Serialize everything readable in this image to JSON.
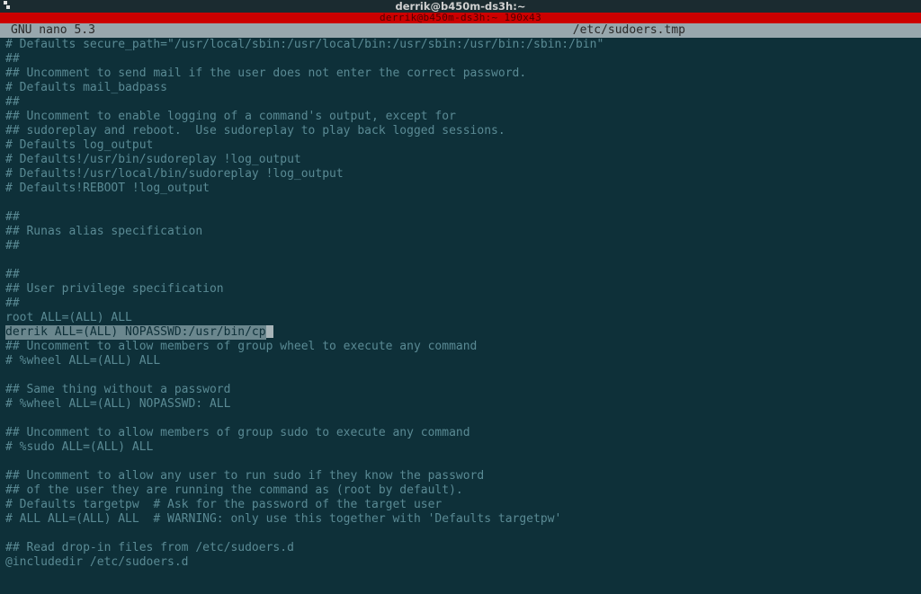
{
  "window": {
    "title": "derrik@b450m-ds3h:~",
    "subtitle": "derrik@b450m-ds3h:~ 190x43"
  },
  "nano": {
    "app_label": "GNU nano 5.3",
    "filename": "/etc/sudoers.tmp"
  },
  "file_lines": [
    "# Defaults secure_path=\"/usr/local/sbin:/usr/local/bin:/usr/sbin:/usr/bin:/sbin:/bin\"",
    "##",
    "## Uncomment to send mail if the user does not enter the correct password.",
    "# Defaults mail_badpass",
    "##",
    "## Uncomment to enable logging of a command's output, except for",
    "## sudoreplay and reboot.  Use sudoreplay to play back logged sessions.",
    "# Defaults log_output",
    "# Defaults!/usr/bin/sudoreplay !log_output",
    "# Defaults!/usr/local/bin/sudoreplay !log_output",
    "# Defaults!REBOOT !log_output",
    "",
    "##",
    "## Runas alias specification",
    "##",
    "",
    "##",
    "## User privilege specification",
    "##",
    "root ALL=(ALL) ALL",
    "derrik ALL=(ALL) NOPASSWD:/usr/bin/cp",
    "## Uncomment to allow members of group wheel to execute any command",
    "# %wheel ALL=(ALL) ALL",
    "",
    "## Same thing without a password",
    "# %wheel ALL=(ALL) NOPASSWD: ALL",
    "",
    "## Uncomment to allow members of group sudo to execute any command",
    "# %sudo ALL=(ALL) ALL",
    "",
    "## Uncomment to allow any user to run sudo if they know the password",
    "## of the user they are running the command as (root by default).",
    "# Defaults targetpw  # Ask for the password of the target user",
    "# ALL ALL=(ALL) ALL  # WARNING: only use this together with 'Defaults targetpw'",
    "",
    "## Read drop-in files from /etc/sudoers.d",
    "@includedir /etc/sudoers.d"
  ],
  "highlighted_line_index": 20
}
